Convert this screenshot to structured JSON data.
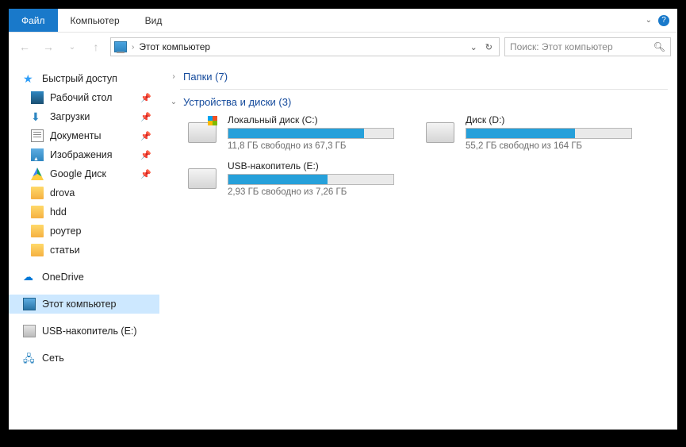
{
  "menubar": {
    "file": "Файл",
    "computer": "Компьютер",
    "view": "Вид"
  },
  "address": {
    "location": "Этот компьютер",
    "search_placeholder": "Поиск: Этот компьютер"
  },
  "sidebar": {
    "quick_access": "Быстрый доступ",
    "quick_items": [
      {
        "label": "Рабочий стол",
        "icon": "desktop",
        "pinned": true
      },
      {
        "label": "Загрузки",
        "icon": "downloads",
        "pinned": true
      },
      {
        "label": "Документы",
        "icon": "documents",
        "pinned": true
      },
      {
        "label": "Изображения",
        "icon": "pictures",
        "pinned": true
      },
      {
        "label": "Google Диск",
        "icon": "gdrive",
        "pinned": true
      },
      {
        "label": "drova",
        "icon": "folder",
        "pinned": false
      },
      {
        "label": "hdd",
        "icon": "folder",
        "pinned": false
      },
      {
        "label": "роутер",
        "icon": "folder",
        "pinned": false
      },
      {
        "label": "статьи",
        "icon": "folder",
        "pinned": false
      }
    ],
    "onedrive": "OneDrive",
    "this_pc": "Этот компьютер",
    "usb": "USB-накопитель (E:)",
    "network": "Сеть"
  },
  "groups": {
    "folders": {
      "title": "Папки (7)"
    },
    "devices": {
      "title": "Устройства и диски (3)",
      "drives": [
        {
          "name": "Локальный диск (C:)",
          "stats": "11,8 ГБ свободно из 67,3 ГБ",
          "fill_pct": 82,
          "win": true
        },
        {
          "name": "Диск (D:)",
          "stats": "55,2 ГБ свободно из 164 ГБ",
          "fill_pct": 66,
          "win": false
        },
        {
          "name": "USB-накопитель (E:)",
          "stats": "2,93 ГБ свободно из 7,26 ГБ",
          "fill_pct": 60,
          "win": false
        }
      ]
    }
  }
}
